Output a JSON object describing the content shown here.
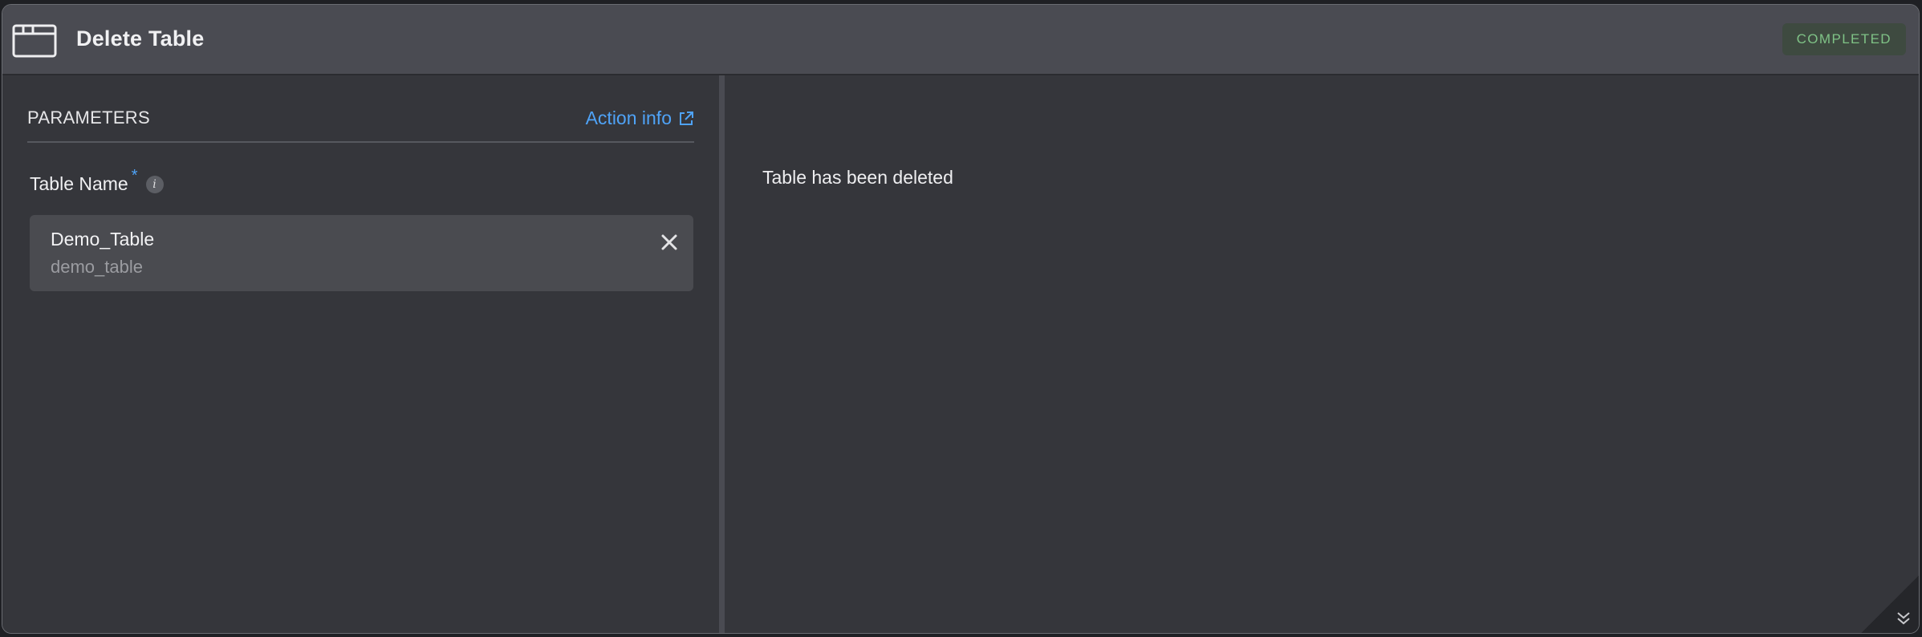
{
  "header": {
    "icon": "window-icon",
    "title": "Delete Table",
    "status": "COMPLETED"
  },
  "parameters": {
    "title": "PARAMETERS",
    "action_link": "Action info",
    "action_link_icon": "external-link-icon",
    "field_label": "Table Name",
    "required_marker": "*",
    "info_icon": "i",
    "selected_item": {
      "name": "Demo_Table",
      "sub": "demo_table"
    }
  },
  "result": {
    "message": "Table has been deleted"
  },
  "colors": {
    "accent": "#4fa3f7",
    "status_green": "#7fc286",
    "background": "#35363b",
    "header": "#4a4b52"
  }
}
